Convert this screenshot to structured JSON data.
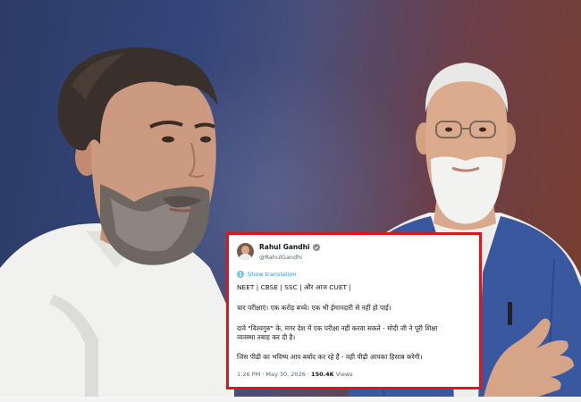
{
  "tweet": {
    "author_name": "Rahul Gandhi",
    "author_handle": "@RahulGandhi",
    "show_translation": "Show translation",
    "lines": [
      "NEET | CBSE | SSC | और आज CUET |",
      "चार परीक्षाएं। एक करोड़ बच्चे। एक भी ईमानदारी से नहीं हो पाई।",
      "दावे \"विश्वगुरु\" के, मगर देश में एक परीक्षा नहीं करवा सकते - मोदी जी ने पूरी शिक्षा",
      "व्यवस्था तबाह कर दी है।",
      "जिस पीढ़ी का भविष्य आप बर्बाद कर रहे हैं - वही पीढ़ी आपका हिसाब करेगी।"
    ],
    "time_date": "1:26 PM · May 30, 2026 · ",
    "views_count": "150.4K",
    "views_label": " Views"
  },
  "icons": {
    "verified": "verified-badge-icon",
    "globe": "globe-icon"
  },
  "colors": {
    "highlight_border": "#e0141b",
    "link_blue": "#1d9bf0",
    "background_left": "#2c3c66",
    "background_right": "#7a3e2e"
  }
}
